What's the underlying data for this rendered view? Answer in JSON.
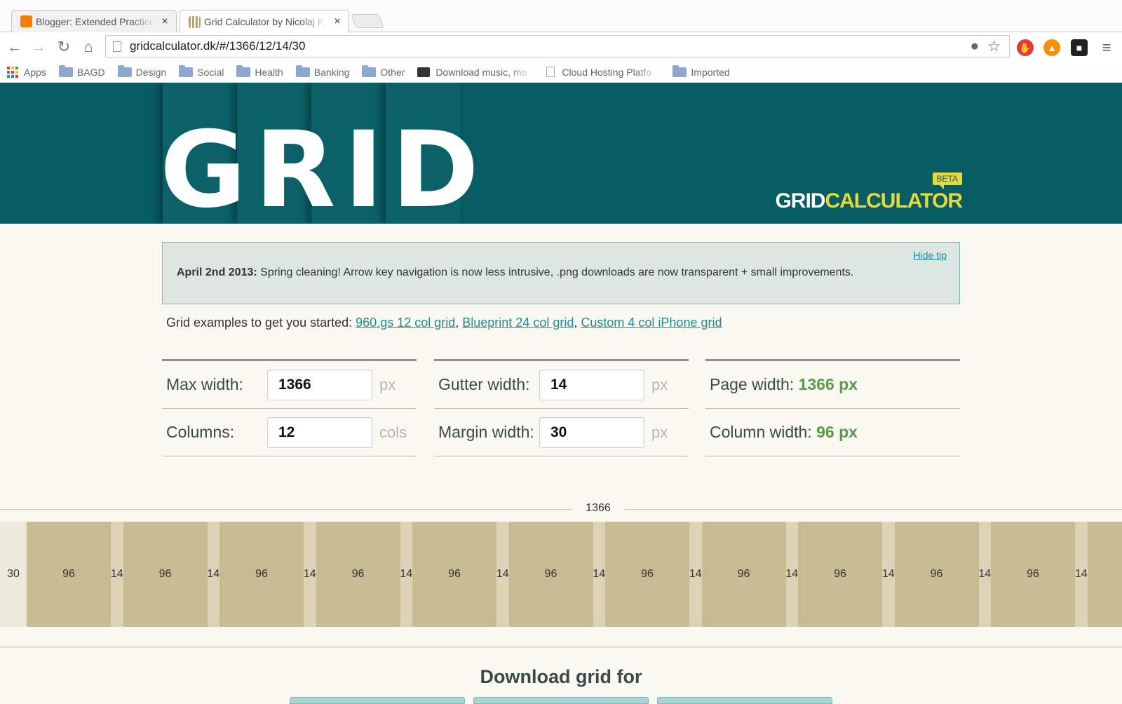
{
  "browser": {
    "tabs": [
      {
        "title": "Blogger: Extended Practice",
        "favicon_color": "#f57d00",
        "active": false
      },
      {
        "title": "Grid Calculator by Nicolaj K",
        "favicon_color": "#b8a46a",
        "active": true
      }
    ],
    "tab_close": "×",
    "url": "gridcalculator.dk/#/1366/12/14/30",
    "bookmarks": [
      {
        "label": "Apps",
        "type": "apps"
      },
      {
        "label": "BAGD",
        "type": "folder"
      },
      {
        "label": "Design",
        "type": "folder"
      },
      {
        "label": "Social",
        "type": "folder"
      },
      {
        "label": "Health",
        "type": "folder"
      },
      {
        "label": "Banking",
        "type": "folder"
      },
      {
        "label": "Other",
        "type": "folder"
      },
      {
        "label": "Download music, mo",
        "type": "site"
      },
      {
        "label": "Cloud Hosting Platfo",
        "type": "doc"
      },
      {
        "label": "Imported",
        "type": "folder"
      }
    ]
  },
  "header": {
    "logo_text": "GRID",
    "title_white": "GRID",
    "title_yellow": "CALCULATOR",
    "badge": "BETA",
    "bg_color": "#075d64",
    "accent_color": "#e8d93a"
  },
  "tip": {
    "hide_label": "Hide tip",
    "date": "April 2nd 2013:",
    "message": "Spring cleaning! Arrow key navigation is now less intrusive, .png downloads are now transparent + small improvements."
  },
  "examples": {
    "intro": "Grid examples to get you started:",
    "links": [
      "960.gs 12 col grid",
      "Blueprint 24 col grid",
      "Custom 4 col iPhone grid"
    ]
  },
  "form": {
    "max_width": {
      "label": "Max width:",
      "value": "1366",
      "unit": "px"
    },
    "columns": {
      "label": "Columns:",
      "value": "12",
      "unit": "cols"
    },
    "gutter_width": {
      "label": "Gutter width:",
      "value": "14",
      "unit": "px"
    },
    "margin_width": {
      "label": "Margin width:",
      "value": "30",
      "unit": "px"
    },
    "page_width": {
      "label": "Page width:",
      "value": "1366 px"
    },
    "column_width": {
      "label": "Column width:",
      "value": "96 px"
    }
  },
  "grid_preview": {
    "total": "1366",
    "margin": "30",
    "column": "96",
    "gutter": "14",
    "visible_columns": 11
  },
  "download": {
    "title": "Download grid for"
  }
}
